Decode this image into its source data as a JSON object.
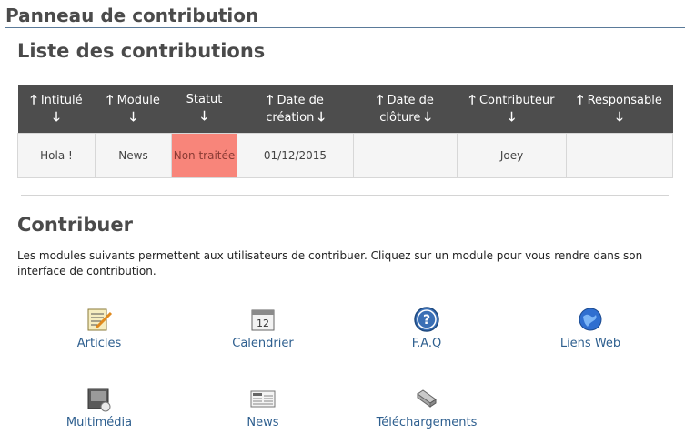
{
  "panel": {
    "title": "Panneau de contribution"
  },
  "list": {
    "title": "Liste des contributions",
    "columns": [
      {
        "label": "Intitulé"
      },
      {
        "label": "Module"
      },
      {
        "label": "Statut"
      },
      {
        "label": "Date de création"
      },
      {
        "label": "Date de clôture"
      },
      {
        "label": "Contributeur"
      },
      {
        "label": "Responsable"
      }
    ],
    "rows": [
      {
        "title": "Hola !",
        "module": "News",
        "status": "Non traitée",
        "created": "01/12/2015",
        "closed": "-",
        "contributor": "Joey",
        "manager": "-"
      }
    ],
    "status_color": "#f8857a"
  },
  "contribute": {
    "title": "Contribuer",
    "description": "Les modules suivants permettent aux utilisateurs de contribuer. Cliquez sur un module pour vous rendre dans son interface de contribution.",
    "modules": [
      {
        "label": "Articles",
        "icon": "article-icon"
      },
      {
        "label": "Calendrier",
        "icon": "calendar-icon"
      },
      {
        "label": "F.A.Q",
        "icon": "help-icon"
      },
      {
        "label": "Liens Web",
        "icon": "globe-icon"
      },
      {
        "label": "Multimédia",
        "icon": "media-icon"
      },
      {
        "label": "News",
        "icon": "newspaper-icon"
      },
      {
        "label": "Téléchargements",
        "icon": "download-icon"
      }
    ]
  }
}
